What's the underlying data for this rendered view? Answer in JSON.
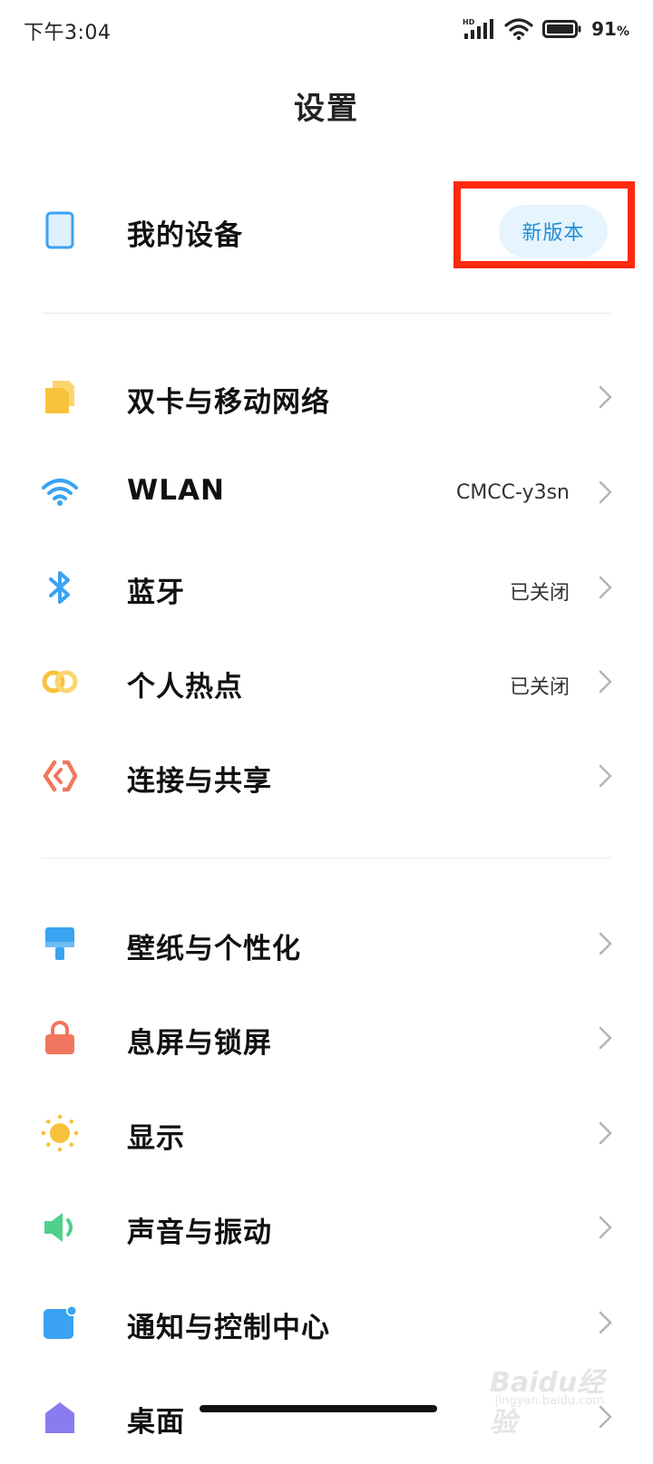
{
  "status_bar": {
    "time": "下午3:04",
    "network_badge": "HD",
    "battery_percent": "91",
    "battery_suffix": "%",
    "icons": [
      "hd-badge-icon",
      "signal-icon",
      "wifi-icon",
      "battery-icon"
    ]
  },
  "header": {
    "title": "设置"
  },
  "my_device": {
    "label": "我的设备",
    "badge": "新版本",
    "icon": "phone-icon"
  },
  "network_section": [
    {
      "label": "双卡与移动网络",
      "value": "",
      "icon": "sim-card-icon",
      "color": "#f9c23c"
    },
    {
      "label": "WLAN",
      "value": "CMCC-y3sn",
      "icon": "wifi-icon",
      "color": "#3aa3f2"
    },
    {
      "label": "蓝牙",
      "value": "已关闭",
      "icon": "bluetooth-icon",
      "color": "#3aa3f2"
    },
    {
      "label": "个人热点",
      "value": "已关闭",
      "icon": "hotspot-icon",
      "color": "#f9c23c"
    },
    {
      "label": "连接与共享",
      "value": "",
      "icon": "connection-share-icon",
      "color": "#f2765f"
    }
  ],
  "personal_section": [
    {
      "label": "壁纸与个性化",
      "icon": "wallpaper-icon",
      "color": "#3aa3f2"
    },
    {
      "label": "息屏与锁屏",
      "icon": "lock-icon",
      "color": "#f2765f"
    },
    {
      "label": "显示",
      "icon": "brightness-icon",
      "color": "#f9c23c"
    },
    {
      "label": "声音与振动",
      "icon": "speaker-icon",
      "color": "#4fd18b"
    },
    {
      "label": "通知与控制中心",
      "icon": "notification-icon",
      "color": "#3aa3f2"
    },
    {
      "label": "桌面",
      "icon": "home-icon",
      "color": "#8a7cf0"
    }
  ],
  "watermark": {
    "main": "Baidu经验",
    "sub": "jingyan.baidu.com"
  },
  "colors": {
    "accent": "#1f8dd6",
    "highlight": "#ff2a10",
    "badge_bg": "#e6f4fd"
  }
}
